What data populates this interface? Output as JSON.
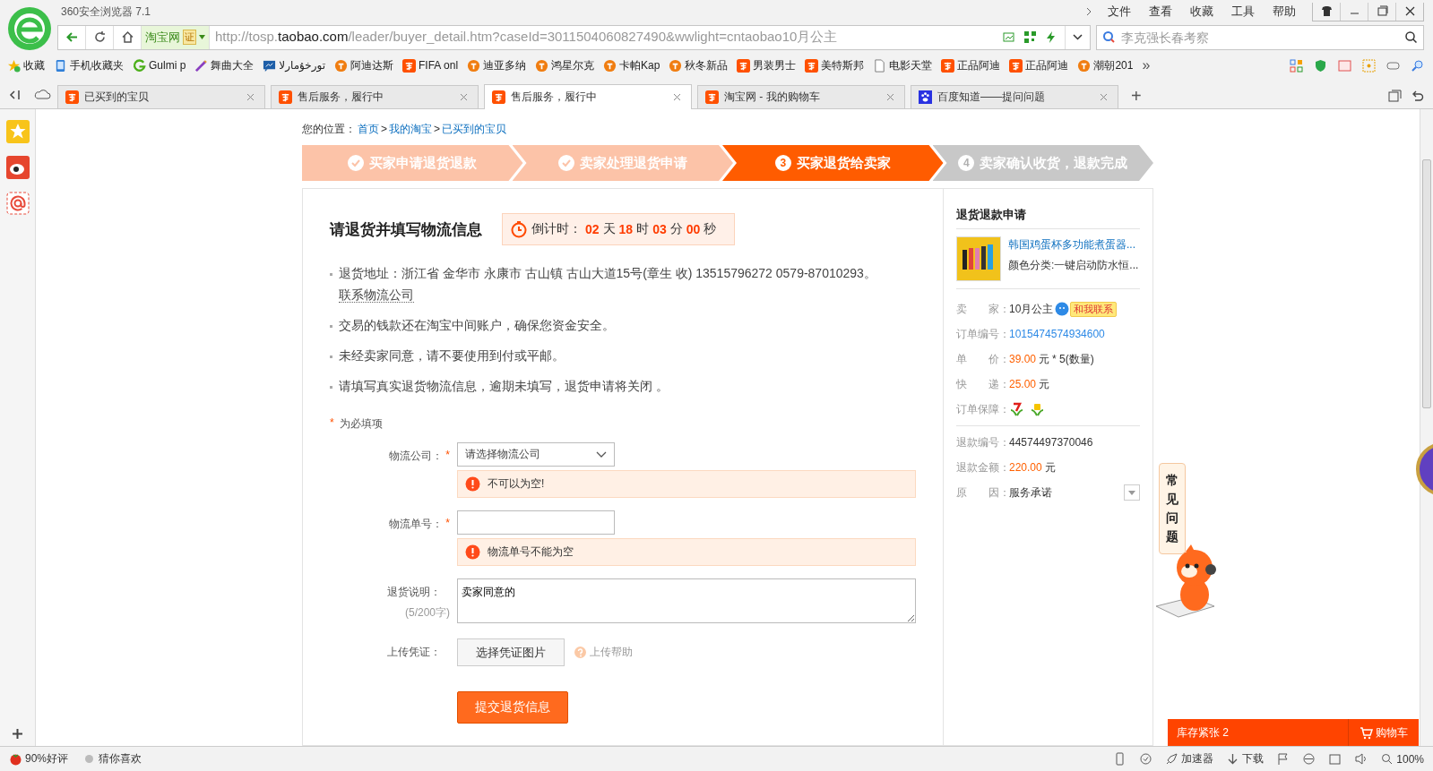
{
  "browser": {
    "title": "360安全浏览器 7.1",
    "menu": [
      "文件",
      "查看",
      "收藏",
      "工具",
      "帮助"
    ],
    "address": {
      "site_badge": "淘宝网",
      "cert": "证",
      "url_prefix": "http://tosp.",
      "url_host": "taobao.com",
      "url_path": "/leader/buyer_detail.htm?caseId=3011504060827490&wwlight=cntaobao10月公主"
    },
    "search": {
      "placeholder": "李克强长春考察"
    },
    "bookmarks": [
      "收藏",
      "手机收藏夹",
      "Gulmi p",
      "舞曲大全",
      "تورخۇمارلا",
      "阿迪达斯",
      "FIFA onl",
      "迪亚多纳",
      "鸿星尔克",
      "卡帕Kap",
      "秋冬新品",
      "男装男士",
      "美特斯邦",
      "电影天堂",
      "正品阿迪",
      "正品阿迪",
      "潮朝201"
    ],
    "bookmarks_more": "»",
    "tabs": [
      {
        "label": "已买到的宝贝",
        "selected": false
      },
      {
        "label": "售后服务，履行中",
        "selected": false
      },
      {
        "label": "售后服务，履行中",
        "selected": true
      },
      {
        "label": "淘宝网 - 我的购物车",
        "selected": false
      },
      {
        "label": "百度知道——提问问题",
        "selected": false
      }
    ],
    "new_tab": "+"
  },
  "page": {
    "breadcrumb": {
      "label": "您的位置：",
      "links": [
        "首页",
        "我的淘宝",
        "已买到的宝贝"
      ],
      "separator": ">"
    },
    "steps": [
      {
        "kind": "done",
        "label": "买家申请退货退款"
      },
      {
        "kind": "done",
        "label": "卖家处理退货申请"
      },
      {
        "kind": "current",
        "number": "3",
        "label": "买家退货给卖家"
      },
      {
        "kind": "pending",
        "number": "4",
        "label": "卖家确认收货，退款完成"
      }
    ],
    "title": "请退货并填写物流信息",
    "countdown": {
      "label": "倒计时：",
      "parts": [
        {
          "value": "02",
          "unit": "天"
        },
        {
          "value": "18",
          "unit": "时"
        },
        {
          "value": "03",
          "unit": "分"
        },
        {
          "value": "00",
          "unit": "秒"
        }
      ]
    },
    "notes": [
      {
        "text": "退货地址：浙江省 金华市 永康市 古山镇 古山大道15号(章生 收) 13515796272 0579-87010293。",
        "link": "联系物流公司"
      },
      {
        "text": "交易的钱款还在淘宝中间账户，确保您资金安全。"
      },
      {
        "text": "未经卖家同意，请不要使用到付或平邮。"
      },
      {
        "text": "请填写真实退货物流信息，逾期未填写，退货申请将关闭 。"
      }
    ],
    "required_mark": "*",
    "required_hint": "为必填项",
    "form": [
      {
        "kind": "select",
        "label": "物流公司：",
        "required": true,
        "placeholder": "请选择物流公司",
        "error": "不可以为空!"
      },
      {
        "kind": "text",
        "label": "物流单号：",
        "required": true,
        "error": "物流单号不能为空"
      },
      {
        "kind": "textarea",
        "label": "退货说明：",
        "sublabel": "(5/200字)",
        "required": false,
        "value": "卖家同意的"
      },
      {
        "kind": "upload",
        "label": "上传凭证：",
        "required": false,
        "button": "选择凭证图片",
        "help": "上传帮助"
      }
    ],
    "submit": "提交退货信息",
    "sidebar": {
      "title": "退货退款申请",
      "product": {
        "title": "韩国鸡蛋杯多功能煮蛋器...",
        "sku": "颜色分类:一键启动防水恒..."
      },
      "rows": [
        {
          "kind": "seller",
          "label": "卖　　家：",
          "value": "10月公主",
          "badge": "和我联系"
        },
        {
          "kind": "link",
          "label": "订单编号：",
          "value": "1015474574934600"
        },
        {
          "kind": "price",
          "label": "单　　价：",
          "value": "39.00",
          "unit": "元",
          "extra": "* 5(数量)"
        },
        {
          "kind": "price",
          "label": "快　　递：",
          "value": "25.00",
          "unit": "元"
        },
        {
          "kind": "icons",
          "label": "订单保障："
        },
        {
          "kind": "divider"
        },
        {
          "kind": "text",
          "label": "退款编号：",
          "value": "44574497370046"
        },
        {
          "kind": "price",
          "label": "退款金额：",
          "value": "220.00",
          "unit": "元"
        },
        {
          "kind": "select",
          "label": "原　　因：",
          "value": "服务承诺"
        }
      ]
    },
    "faq": "常见问题",
    "cart_widget": {
      "stock": "库存紧张 2",
      "cart": "购物车"
    }
  },
  "status_bar": {
    "left": [
      "90%好评",
      "猜你喜欢"
    ],
    "accelerator": "加速器",
    "download": "下载",
    "zoom": "100%"
  }
}
